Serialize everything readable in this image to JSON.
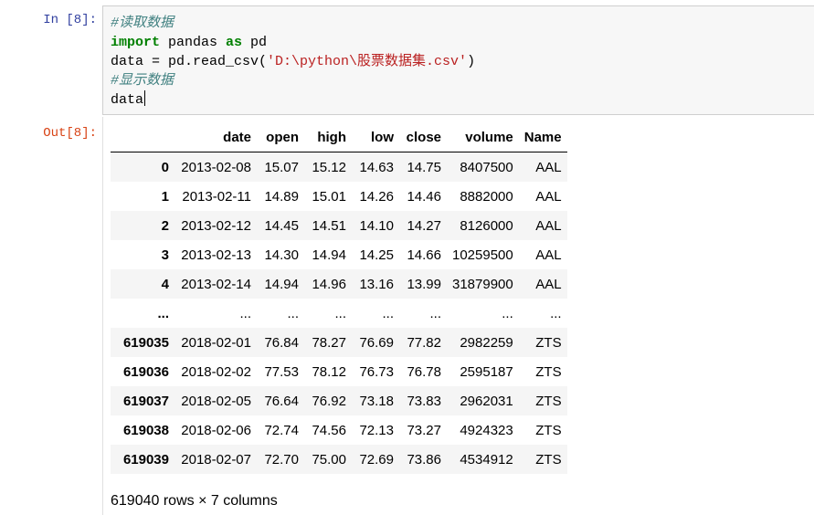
{
  "input_cell": {
    "prompt": "In  [8]:",
    "lines": {
      "comment1": "#读取数据",
      "import_kw": "import",
      "import_mod": " pandas ",
      "as_kw": "as",
      "import_alias": " pd",
      "assign_pre": "data = pd.read_csv(",
      "path": "'D:\\python\\股票数据集.csv'",
      "assign_post": ")",
      "comment2": "#显示数据",
      "last": "data"
    }
  },
  "output_cell": {
    "prompt": "Out[8]:",
    "columns": [
      "",
      "date",
      "open",
      "high",
      "low",
      "close",
      "volume",
      "Name"
    ],
    "rows": [
      {
        "index": "0",
        "cells": [
          "2013-02-08",
          "15.07",
          "15.12",
          "14.63",
          "14.75",
          "8407500",
          "AAL"
        ]
      },
      {
        "index": "1",
        "cells": [
          "2013-02-11",
          "14.89",
          "15.01",
          "14.26",
          "14.46",
          "8882000",
          "AAL"
        ]
      },
      {
        "index": "2",
        "cells": [
          "2013-02-12",
          "14.45",
          "14.51",
          "14.10",
          "14.27",
          "8126000",
          "AAL"
        ]
      },
      {
        "index": "3",
        "cells": [
          "2013-02-13",
          "14.30",
          "14.94",
          "14.25",
          "14.66",
          "10259500",
          "AAL"
        ]
      },
      {
        "index": "4",
        "cells": [
          "2013-02-14",
          "14.94",
          "14.96",
          "13.16",
          "13.99",
          "31879900",
          "AAL"
        ]
      },
      {
        "index": "...",
        "cells": [
          "...",
          "...",
          "...",
          "...",
          "...",
          "...",
          "..."
        ]
      },
      {
        "index": "619035",
        "cells": [
          "2018-02-01",
          "76.84",
          "78.27",
          "76.69",
          "77.82",
          "2982259",
          "ZTS"
        ]
      },
      {
        "index": "619036",
        "cells": [
          "2018-02-02",
          "77.53",
          "78.12",
          "76.73",
          "76.78",
          "2595187",
          "ZTS"
        ]
      },
      {
        "index": "619037",
        "cells": [
          "2018-02-05",
          "76.64",
          "76.92",
          "73.18",
          "73.83",
          "2962031",
          "ZTS"
        ]
      },
      {
        "index": "619038",
        "cells": [
          "2018-02-06",
          "72.74",
          "74.56",
          "72.13",
          "73.27",
          "4924323",
          "ZTS"
        ]
      },
      {
        "index": "619039",
        "cells": [
          "2018-02-07",
          "72.70",
          "75.00",
          "72.69",
          "73.86",
          "4534912",
          "ZTS"
        ]
      }
    ],
    "shape_text": "619040 rows × 7 columns"
  },
  "colors": {
    "in_prompt": "#303f9f",
    "out_prompt": "#d84315",
    "comment": "#408080",
    "keyword": "#008000",
    "string": "#ba2121"
  }
}
